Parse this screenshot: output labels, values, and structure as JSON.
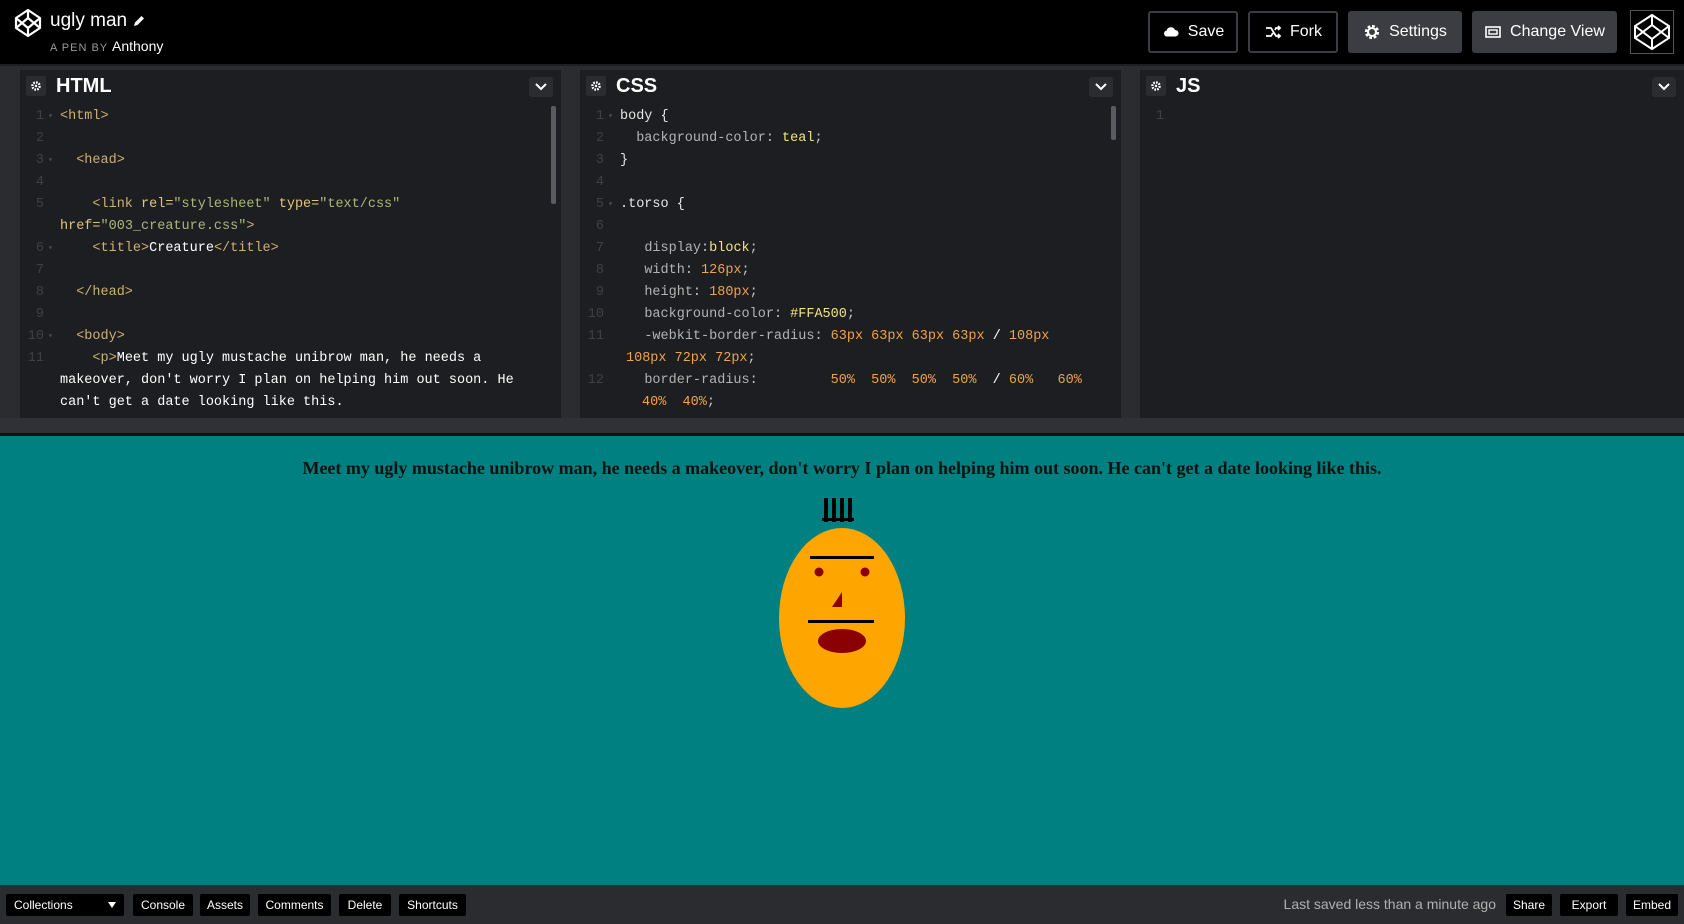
{
  "header": {
    "pen_title": "ugly man",
    "pen_by_prefix": "A PEN BY",
    "author": "Anthony",
    "buttons": {
      "save": "Save",
      "fork": "Fork",
      "settings": "Settings",
      "change_view": "Change View"
    }
  },
  "editors": {
    "html": {
      "title": "HTML",
      "line_numbers": [
        "1",
        "2",
        "3",
        "4",
        "5",
        "",
        "6",
        "7",
        "8",
        "9",
        "10",
        "11",
        "",
        "",
        ""
      ]
    },
    "css": {
      "title": "CSS",
      "line_numbers": [
        "1",
        "2",
        "3",
        "4",
        "5",
        "6",
        "7",
        "8",
        "9",
        "10",
        "11",
        "",
        "12",
        ""
      ]
    },
    "js": {
      "title": "JS",
      "line_numbers": [
        "1"
      ]
    }
  },
  "code": {
    "html": {
      "l1": "<html>",
      "l3": "<head>",
      "l5a": "<link ",
      "l5_rel_attr": "rel=",
      "l5_rel_val": "\"stylesheet\"",
      "l5_type_attr": " type=",
      "l5_type_val": "\"text/css\"",
      "l5b_attr": "href=",
      "l5b_val": "\"003_creature.css\"",
      "l5b_end": ">",
      "l6_open": "<title>",
      "l6_text": "Creature",
      "l6_close": "</title>",
      "l8": "</head>",
      "l10": "<body>",
      "l11_open": "<p>",
      "l11_text": "Meet my ugly mustache unibrow man, he needs a",
      "l11_cont1": "makeover, don't worry I plan on helping him out soon. He",
      "l11_cont2": "can't get a date looking like this."
    },
    "css": {
      "l1_sel": "body",
      "l1_brace": " {",
      "l2_prop": "background-color",
      "l2_val": "teal",
      "l3": "}",
      "l5_sel": ".torso",
      "l5_brace": " {",
      "l7_prop": "display",
      "l7_val": "block",
      "l8_prop": "width",
      "l8_val": "126px",
      "l9_prop": "height",
      "l9_val": "180px",
      "l10_prop": "background-color",
      "l10_val": "#FFA500",
      "l11_prop": "-webkit-border-radius",
      "l11_val": "63px 63px 63px 63px",
      "l11_slash": " / ",
      "l11_val2": "108px",
      "l11_cont": "108px 72px 72px",
      "l12_prop": "border-radius",
      "l12_val": "50%  50%  50%  50%",
      "l12_slash": "  / ",
      "l12_val2": "60%   60%",
      "l12_cont": "40%  40%"
    }
  },
  "preview": {
    "paragraph": "Meet my ugly mustache unibrow man, he needs a makeover, don't worry I plan on helping him out soon. He can't get a date looking like this.",
    "colors": {
      "background": "#008080",
      "face": "#FFA500",
      "features": "#8B0000"
    }
  },
  "footer": {
    "collections": "Collections",
    "console": "Console",
    "assets": "Assets",
    "comments": "Comments",
    "delete": "Delete",
    "shortcuts": "Shortcuts",
    "last_saved": "Last saved less than a minute ago",
    "share": "Share",
    "export": "Export",
    "embed": "Embed"
  }
}
